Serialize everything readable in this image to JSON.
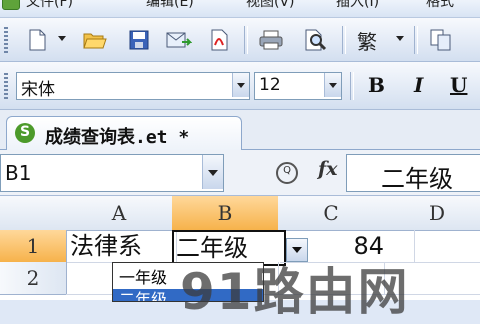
{
  "menu_bar": {
    "items": [
      "文件(F)",
      "编辑(E)",
      "视图(V)",
      "插入(I)",
      "格式"
    ]
  },
  "toolbar_standard": {
    "icons": [
      "new-document-icon",
      "open-folder-icon",
      "save-icon",
      "email-icon",
      "pdf-export-icon",
      "print-icon",
      "print-preview-icon",
      "traditional-chinese-icon",
      "copy-icon"
    ],
    "traditional_label": "繁"
  },
  "toolbar_format": {
    "font_name": "宋体",
    "font_size": "12",
    "bold_label": "B",
    "italic_label": "I",
    "underline_label": "U"
  },
  "document_tab": {
    "title": "成绩查询表.et *"
  },
  "formula_bar": {
    "name_box": "B1",
    "fx_label": "fx",
    "content": "二年级"
  },
  "sheet": {
    "columns": [
      "A",
      "B",
      "C",
      "D"
    ],
    "active_column": "B",
    "rows": [
      {
        "header": "1",
        "A": "法律系",
        "B": "二年级",
        "C": "84",
        "D": ""
      },
      {
        "header": "2",
        "A": "",
        "B": "",
        "C": "",
        "D": ""
      }
    ],
    "active_row": "1"
  },
  "validation_dropdown": {
    "options": [
      "一年级",
      "二年级"
    ],
    "highlighted": "二年级"
  },
  "watermark": "91路由网",
  "colors": {
    "active_header": "#f6b24b",
    "selection": "#316ac5",
    "toolbar_bg": "#d3dff0"
  }
}
